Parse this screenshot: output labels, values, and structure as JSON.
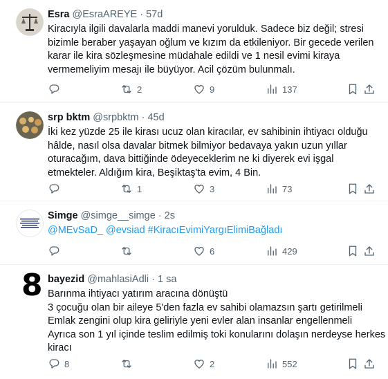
{
  "tweets": [
    {
      "name": "Esra",
      "handle": "@EsraAREYE",
      "dot": "·",
      "time": "57d",
      "lines": [
        "Kiracıyla ilgili davalarla maddi manevi yorulduk. Sadece biz değil; stresi",
        "bizimle beraber yaşayan oğlum ve kızım  da etkileniyor. Bir gecede verilen",
        "karar ile kira sözleşmesine müdahale edildi ve 1 nesil evimi kiraya",
        "vermemeliyim mesajı ile büyüyor. Acil çözüm bulunmalı."
      ],
      "replies": "",
      "retweets": "2",
      "likes": "9",
      "views": "137"
    },
    {
      "name": "srp bktm",
      "handle": "@srpbktm",
      "dot": "·",
      "time": "45d",
      "lines": [
        "İki kez yüzde 25 ile kirası ucuz olan kiracılar, ev sahibinin ihtiyacı olduğu",
        "hâlde, nasıl olsa davalar bitmek bilmiyor bedavaya yakın uzun yıllar",
        "oturacağım, dava bittiğinde ödeyeceklerim ne ki diyerek evi işgal",
        "etmekteler. Aldığım kira, Beşiktaş'ta evim, 4 Bin."
      ],
      "replies": "",
      "retweets": "1",
      "likes": "3",
      "views": "73"
    },
    {
      "name": "Simge",
      "handle": "@simge__simge",
      "dot": "·",
      "time": "2s",
      "link_line": "@MEvSaD_ @evsiad #KiracıEvimiYargıElimiBağladı",
      "replies": "",
      "retweets": "",
      "likes": "6",
      "views": "429"
    },
    {
      "name": "bayezid",
      "handle": "@mahlasiAdli",
      "dot": "·",
      "time": "1 sa",
      "avatar_text": "8",
      "lines": [
        "Barınma ihtiyacı yatırım aracına dönüştü",
        "3 çocuğu olan bir aileye 5'den fazla ev sahibi olamazsın şartı getirilmeli",
        "Emlak zengini olup kira geliriyle yeni evler alan insanlar engellenmeli",
        "Ayrıca son 1 yıl içinde teslim edilmiş toki konularını dolaşın nerdeyse herkes",
        "kiracı"
      ],
      "replies": "8",
      "retweets": "",
      "likes": "2",
      "views": "552"
    }
  ],
  "colors": {
    "text": "#0f1419",
    "secondary": "#536471",
    "link": "#1d9bf0",
    "border": "#eff3f4"
  },
  "icons": [
    "reply-icon",
    "retweet-icon",
    "like-icon",
    "views-icon",
    "bookmark-icon",
    "share-icon"
  ]
}
